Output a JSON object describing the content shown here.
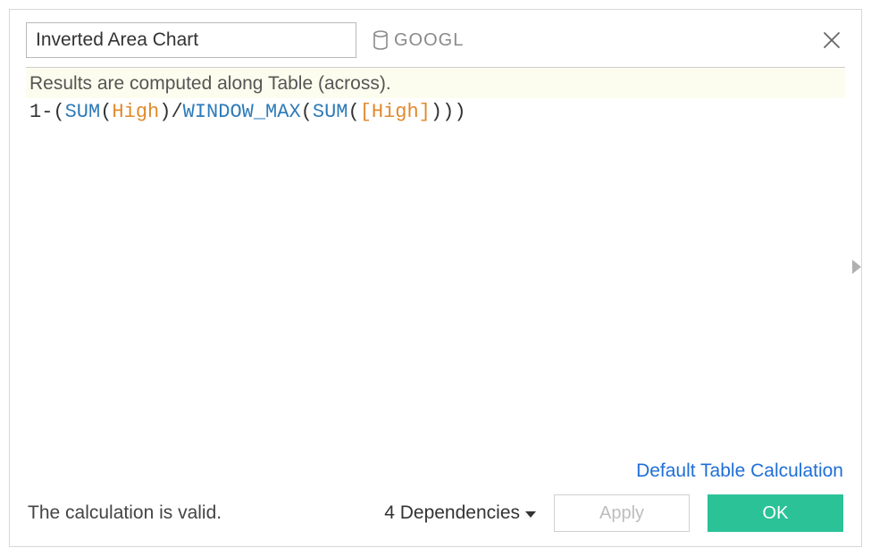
{
  "header": {
    "calc_name": "Inverted Area Chart",
    "datasource": "GOOGL"
  },
  "info_bar": "Results are computed along Table (across).",
  "formula": {
    "raw": "1-(SUM(High)/WINDOW_MAX(SUM([High])))",
    "tokens": [
      {
        "t": "1-",
        "cls": "tok-plain"
      },
      {
        "t": "(",
        "cls": "tok-paren"
      },
      {
        "t": "SUM",
        "cls": "tok-fn"
      },
      {
        "t": "(",
        "cls": "tok-paren"
      },
      {
        "t": "High",
        "cls": "tok-field"
      },
      {
        "t": ")",
        "cls": "tok-paren"
      },
      {
        "t": "/",
        "cls": "tok-plain"
      },
      {
        "t": "WINDOW_MAX",
        "cls": "tok-fn"
      },
      {
        "t": "(",
        "cls": "tok-paren"
      },
      {
        "t": "SUM",
        "cls": "tok-fn"
      },
      {
        "t": "(",
        "cls": "tok-paren"
      },
      {
        "t": "[High]",
        "cls": "tok-field"
      },
      {
        "t": ")",
        "cls": "tok-paren"
      },
      {
        "t": ")",
        "cls": "tok-paren"
      },
      {
        "t": ")",
        "cls": "tok-paren"
      }
    ]
  },
  "link_default": "Default Table Calculation",
  "footer": {
    "status": "The calculation is valid.",
    "deps_label": "4 Dependencies",
    "apply": "Apply",
    "ok": "OK"
  }
}
